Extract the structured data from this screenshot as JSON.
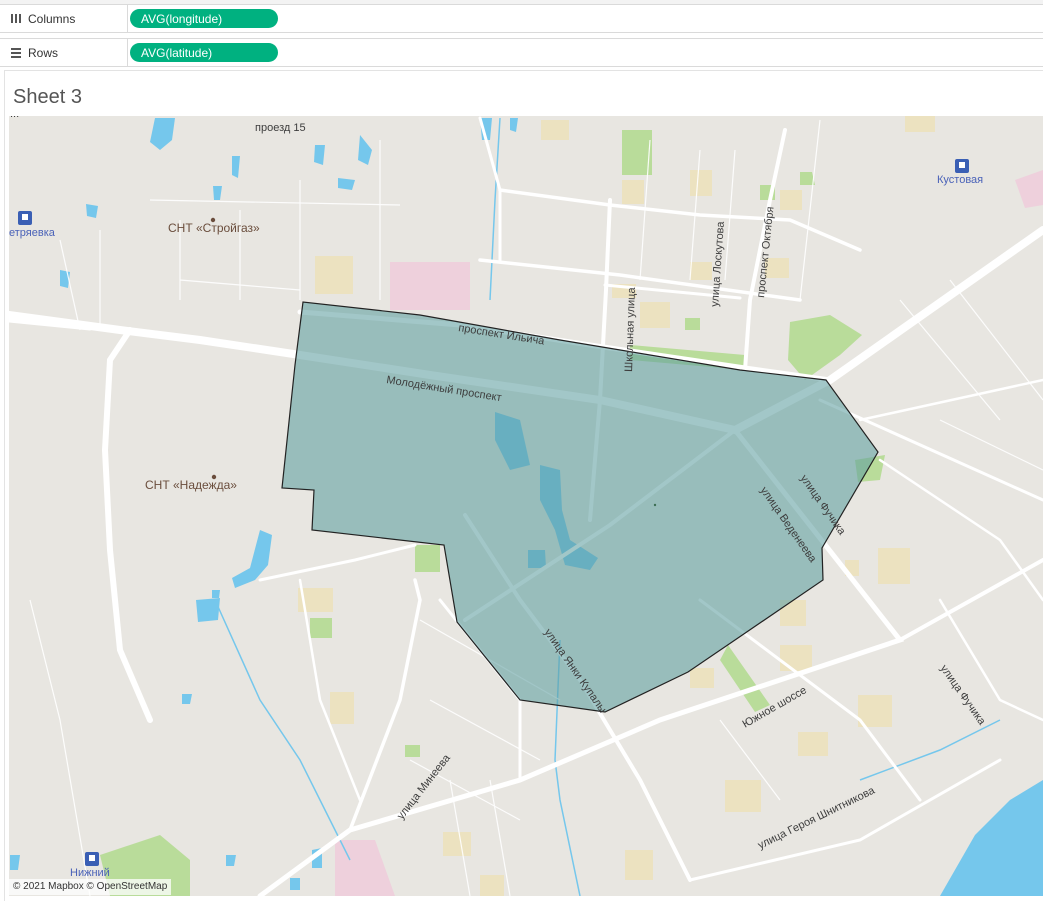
{
  "shelves": {
    "columns": {
      "label": "Columns",
      "icon": "columns-icon",
      "pill": "AVG(longitude)"
    },
    "rows": {
      "label": "Rows",
      "icon": "rows-icon",
      "pill": "AVG(latitude)"
    }
  },
  "sheet": {
    "title": "Sheet 3"
  },
  "map": {
    "labels": {
      "proezd15": "проезд 15",
      "snt_stroygaz": "СНТ «Стройгаз»",
      "snt_nadezhda": "СНТ «Надежда»",
      "kustovaya": "Кустовая",
      "petryaevka": "етряевка",
      "nizhniy": "Нижний",
      "top_cut": "...",
      "prospekt_ilyicha": "проспект Ильича",
      "molodezhny": "Молодёжный проспект",
      "shkolnaya": "Школьная улица",
      "loskutova": "улица Лоскутова",
      "oktyabrya": "проспект Октября",
      "fuchika_1": "улица Фучика",
      "fuchika_2": "улица Фучика",
      "vedeneeva": "улица Веденеева",
      "kupaly": "улица Янки Купалы",
      "yuzhnoe": "Южное шоссе",
      "mineeva": "улица Минеева",
      "shnitnikova": "улица Героя Шнитникова"
    },
    "colors": {
      "background": "#e8e6e1",
      "road": "#ffffff",
      "park": "#b9dc9a",
      "water": "#75c7ec",
      "building_tan": "#ece2c0",
      "industrial_pink": "#eed0dc",
      "polygon_fill": "#5f9ea0",
      "polygon_stroke": "#222222",
      "rail_icon": "#3a5fb4"
    },
    "attribution": "© 2021 Mapbox © OpenStreetMap"
  }
}
